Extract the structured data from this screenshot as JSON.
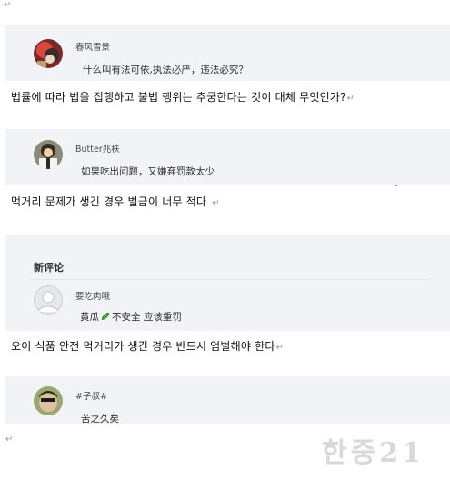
{
  "para_mark": "↵",
  "comments": [
    {
      "username": "春风雪景",
      "text": "什么叫有法可依,执法必严，违法必究？",
      "translation": "법률에 따라 법을 집행하고 불법 행위는 추궁한다는 것이 대체 무엇인가?"
    },
    {
      "username": "Butter兆秩",
      "text": "如果吃出问题，又嫌弃罚款太少",
      "translation": "먹거리 문제가 생긴 경우 벌금이 너무 적다"
    },
    {
      "section_title": "新评论",
      "username": "要吃肉哦",
      "text_pre": "黄瓜",
      "emoji": "cucumber-icon",
      "text_post": "不安全 应该重罚",
      "translation": "오이 식품 안전 먹거리가 생긴 경우 반드시 엄벌해야 한다"
    },
    {
      "username": "#子叔#",
      "text": "苦之久矣"
    }
  ],
  "watermark": "한중21",
  "colors": {
    "card_bg": "#f1f3f6",
    "cucumber": "#3a9a2a"
  }
}
